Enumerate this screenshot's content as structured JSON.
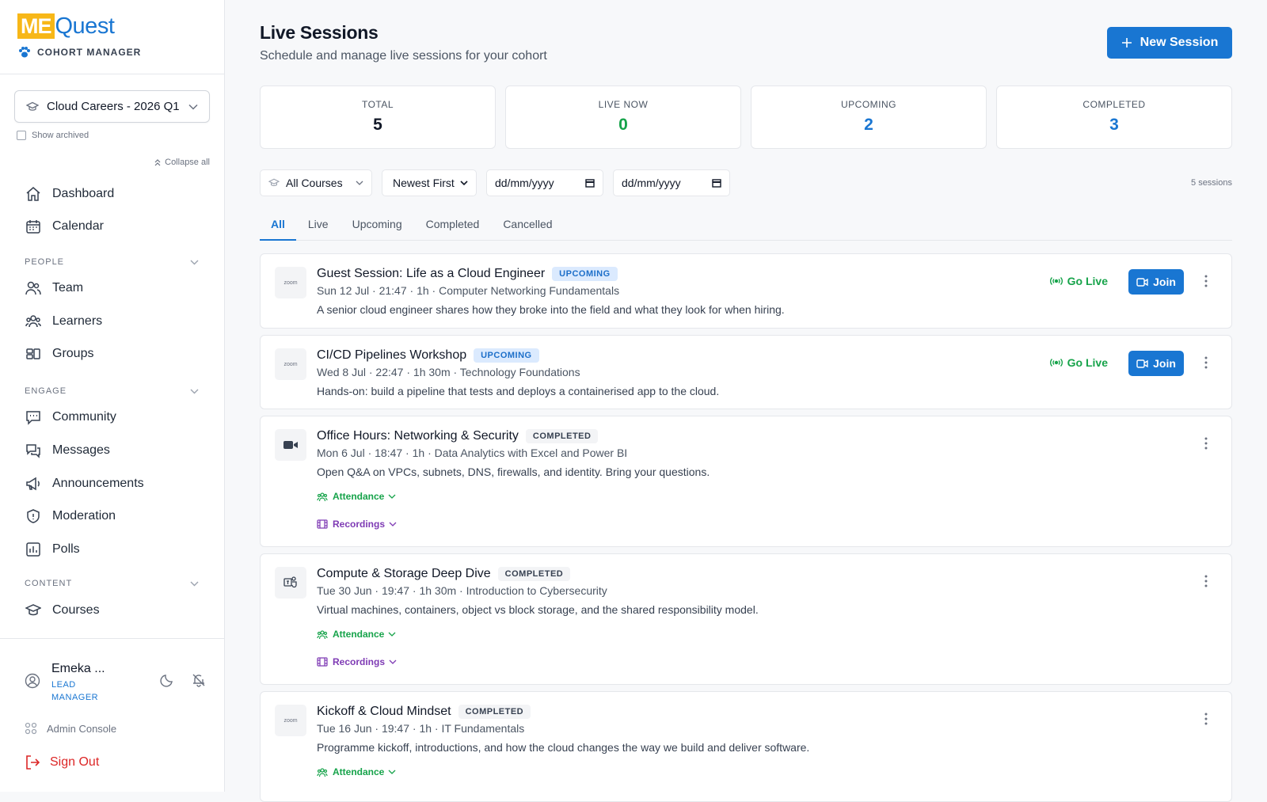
{
  "brand": {
    "logo_me": "ME",
    "logo_quest": "Quest",
    "subtitle": "COHORT MANAGER"
  },
  "sidebar": {
    "cohort": "Cloud Careers - 2026 Q1",
    "show_archived": "Show archived",
    "collapse_all": "Collapse all",
    "top_items": [
      {
        "label": "Dashboard",
        "icon": "home-icon"
      },
      {
        "label": "Calendar",
        "icon": "calendar-icon"
      }
    ],
    "sections": [
      {
        "title": "PEOPLE",
        "items": [
          {
            "label": "Team",
            "icon": "team-icon"
          },
          {
            "label": "Learners",
            "icon": "learners-icon"
          },
          {
            "label": "Groups",
            "icon": "groups-icon"
          }
        ]
      },
      {
        "title": "ENGAGE",
        "items": [
          {
            "label": "Community",
            "icon": "chat-icon"
          },
          {
            "label": "Messages",
            "icon": "messages-icon"
          },
          {
            "label": "Announcements",
            "icon": "megaphone-icon"
          },
          {
            "label": "Moderation",
            "icon": "shield-icon"
          },
          {
            "label": "Polls",
            "icon": "poll-icon"
          }
        ]
      },
      {
        "title": "CONTENT",
        "items": [
          {
            "label": "Courses",
            "icon": "graduation-cap-icon"
          }
        ]
      }
    ],
    "user": {
      "name": "Emeka ...",
      "role": "LEAD MANAGER"
    },
    "admin_console": "Admin Console",
    "sign_out": "Sign Out"
  },
  "header": {
    "title": "Live Sessions",
    "subtitle": "Schedule and manage live sessions for your cohort",
    "new_session": "New Session"
  },
  "stats": [
    {
      "label": "TOTAL",
      "value": "5",
      "color": "#111827"
    },
    {
      "label": "LIVE NOW",
      "value": "0",
      "color": "#16a34a"
    },
    {
      "label": "UPCOMING",
      "value": "2",
      "color": "#1976d2"
    },
    {
      "label": "COMPLETED",
      "value": "3",
      "color": "#1976d2"
    }
  ],
  "filters": {
    "course": "All Courses",
    "sort": "Newest First",
    "date_from": "dd/mm/yyyy",
    "date_to": "dd/mm/yyyy",
    "count": "5 sessions"
  },
  "tabs": [
    "All",
    "Live",
    "Upcoming",
    "Completed",
    "Cancelled"
  ],
  "sessions": [
    {
      "title": "Guest Session: Life as a Cloud Engineer",
      "status": "UPCOMING",
      "platform": "zoom",
      "meta": "Sun 12 Jul · 21:47 · 1h · Computer Networking Fundamentals",
      "desc": "A senior cloud engineer shares how they broke into the field and what they look for when hiring.",
      "go_live": "Go Live",
      "join": "Join"
    },
    {
      "title": "CI/CD Pipelines Workshop",
      "status": "UPCOMING",
      "platform": "zoom",
      "meta": "Wed 8 Jul · 22:47 · 1h 30m · Technology Foundations",
      "desc": "Hands-on: build a pipeline that tests and deploys a containerised app to the cloud.",
      "go_live": "Go Live",
      "join": "Join"
    },
    {
      "title": "Office Hours: Networking & Security",
      "status": "COMPLETED",
      "platform": "video-icon",
      "meta": "Mon 6 Jul · 18:47 · 1h · Data Analytics with Excel and Power BI",
      "desc": "Open Q&A on VPCs, subnets, DNS, firewalls, and identity. Bring your questions.",
      "attendance": "Attendance",
      "recordings": "Recordings"
    },
    {
      "title": "Compute & Storage Deep Dive",
      "status": "COMPLETED",
      "platform": "teams-icon",
      "meta": "Tue 30 Jun · 19:47 · 1h 30m · Introduction to Cybersecurity",
      "desc": "Virtual machines, containers, object vs block storage, and the shared responsibility model.",
      "attendance": "Attendance",
      "recordings": "Recordings"
    },
    {
      "title": "Kickoff & Cloud Mindset",
      "status": "COMPLETED",
      "platform": "zoom",
      "meta": "Tue 16 Jun · 19:47 · 1h · IT Fundamentals",
      "desc": "Programme kickoff, introductions, and how the cloud changes the way we build and deliver software.",
      "attendance": "Attendance"
    }
  ]
}
